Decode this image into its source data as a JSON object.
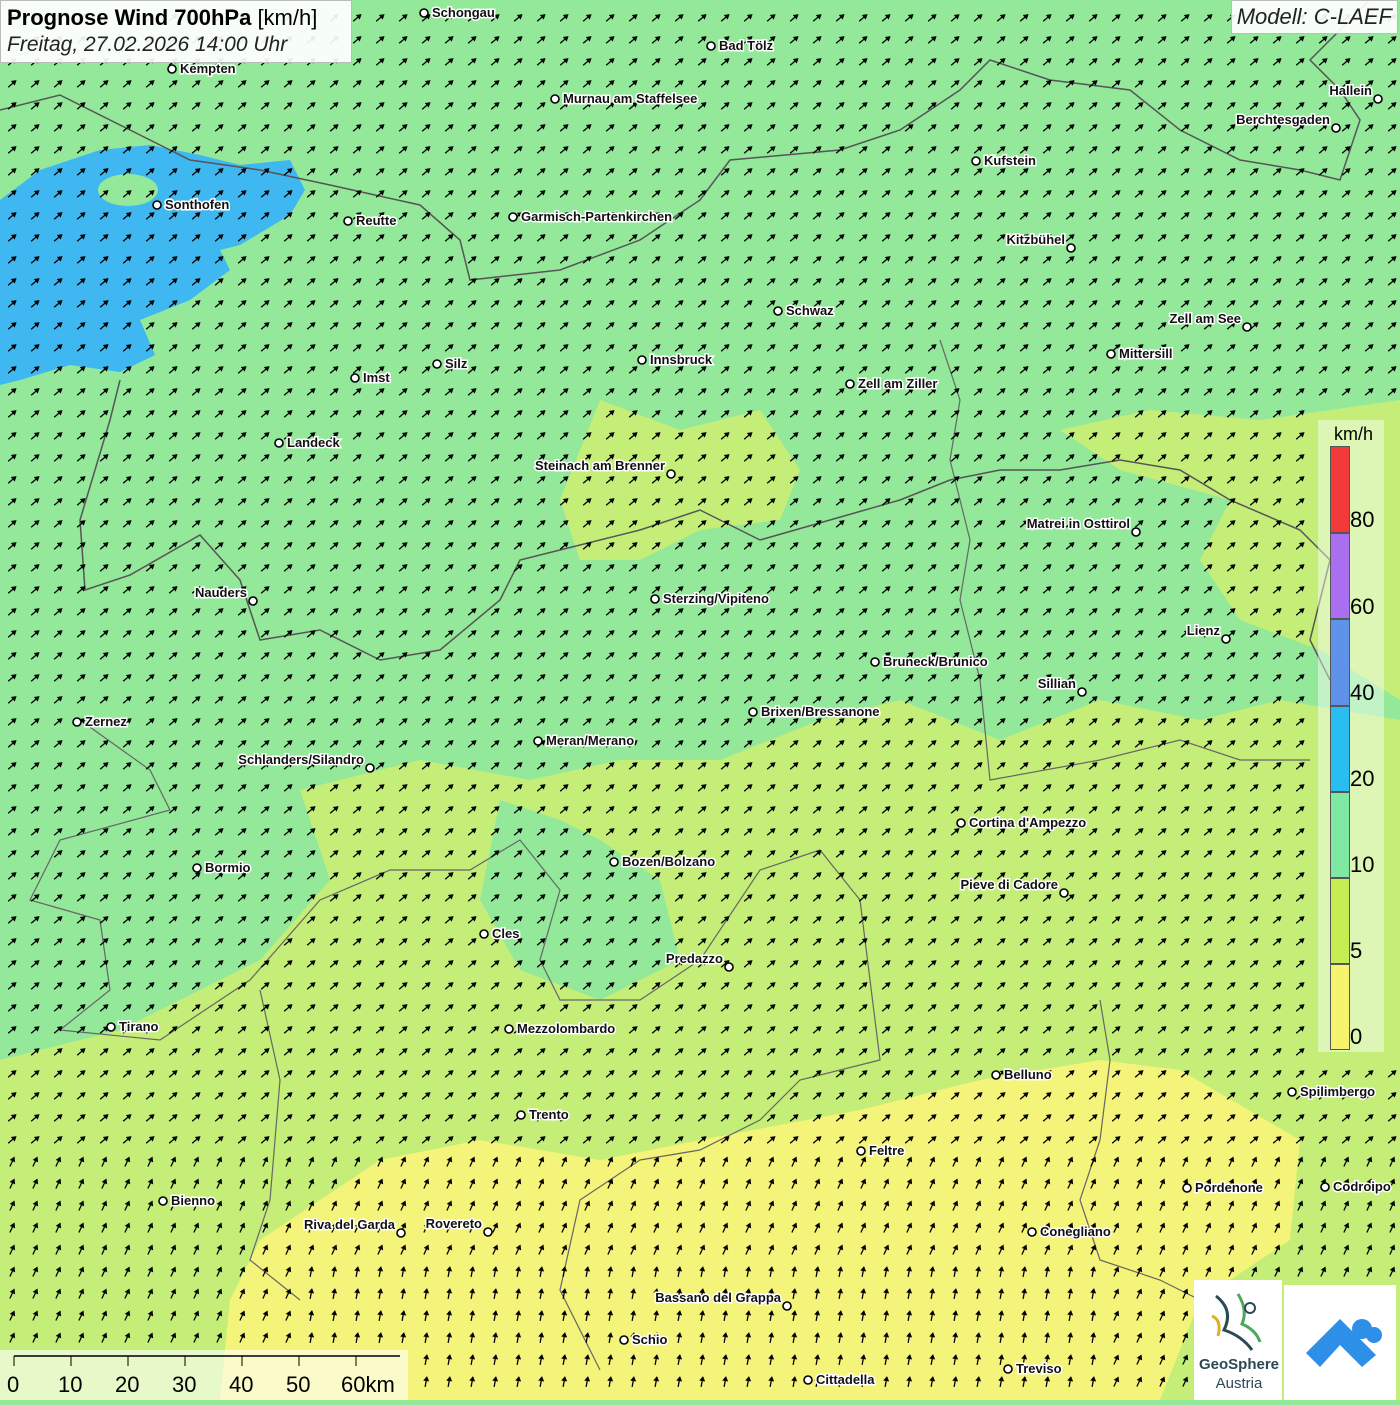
{
  "title": {
    "main": "Prognose Wind 700hPa",
    "unit": "[km/h]",
    "date": "Freitag, 27.02.2026 14:00 Uhr"
  },
  "model_label": "Modell: C-LAEF",
  "legend": {
    "unit": "km/h",
    "ticks": [
      "80",
      "60",
      "40",
      "20",
      "10",
      "5",
      "0"
    ],
    "bands": [
      {
        "color": "#f33a3a"
      },
      {
        "color": "#a96ff0"
      },
      {
        "color": "#5f93ea"
      },
      {
        "color": "#29bdf2"
      },
      {
        "color": "#7fe9a3"
      },
      {
        "color": "#c6ee52"
      },
      {
        "color": "#f6f46c"
      }
    ]
  },
  "scalebar": [
    "0",
    "10",
    "20",
    "30",
    "40",
    "50",
    "60km"
  ],
  "logos": {
    "geosphere_line1": "GeoSphere",
    "geosphere_line2": "Austria"
  },
  "cities": [
    {
      "name": "Schongau"
    },
    {
      "name": "Bad Tölz"
    },
    {
      "name": "Kempten"
    },
    {
      "name": "Murnau am Staffelsee"
    },
    {
      "name": "Hallein"
    },
    {
      "name": "Berchtesgaden"
    },
    {
      "name": "Kufstein"
    },
    {
      "name": "Sonthofen"
    },
    {
      "name": "Reutte"
    },
    {
      "name": "Garmisch-Partenkirchen"
    },
    {
      "name": "Kitzbühel"
    },
    {
      "name": "Schwaz"
    },
    {
      "name": "Zell am See"
    },
    {
      "name": "Mittersill"
    },
    {
      "name": "Innsbruck"
    },
    {
      "name": "Silz"
    },
    {
      "name": "Imst"
    },
    {
      "name": "Zell am Ziller"
    },
    {
      "name": "Landeck"
    },
    {
      "name": "Steinach am Brenner"
    },
    {
      "name": "Matrei in Osttirol"
    },
    {
      "name": "Nauders"
    },
    {
      "name": "Sterzing/Vipiteno"
    },
    {
      "name": "Lienz"
    },
    {
      "name": "Bruneck/Brunico"
    },
    {
      "name": "Sillian"
    },
    {
      "name": "Zernez"
    },
    {
      "name": "Brixen/Bressanone"
    },
    {
      "name": "Meran/Merano"
    },
    {
      "name": "Schlanders/Silandro"
    },
    {
      "name": "Cortina d'Ampezzo"
    },
    {
      "name": "Bormio"
    },
    {
      "name": "Bozen/Bolzano"
    },
    {
      "name": "Pieve di Cadore"
    },
    {
      "name": "Cles"
    },
    {
      "name": "Predazzo"
    },
    {
      "name": "Tirano"
    },
    {
      "name": "Mezzolombardo"
    },
    {
      "name": "Belluno"
    },
    {
      "name": "Spilimbergo"
    },
    {
      "name": "Trento"
    },
    {
      "name": "Feltre"
    },
    {
      "name": "Pordenone"
    },
    {
      "name": "Codroipo"
    },
    {
      "name": "Bienno"
    },
    {
      "name": "Riva del Garda"
    },
    {
      "name": "Rovereto"
    },
    {
      "name": "Conegliano"
    },
    {
      "name": "Bassano del Grappa"
    },
    {
      "name": "Schio"
    },
    {
      "name": "Treviso"
    },
    {
      "name": "Cittadella"
    }
  ]
}
